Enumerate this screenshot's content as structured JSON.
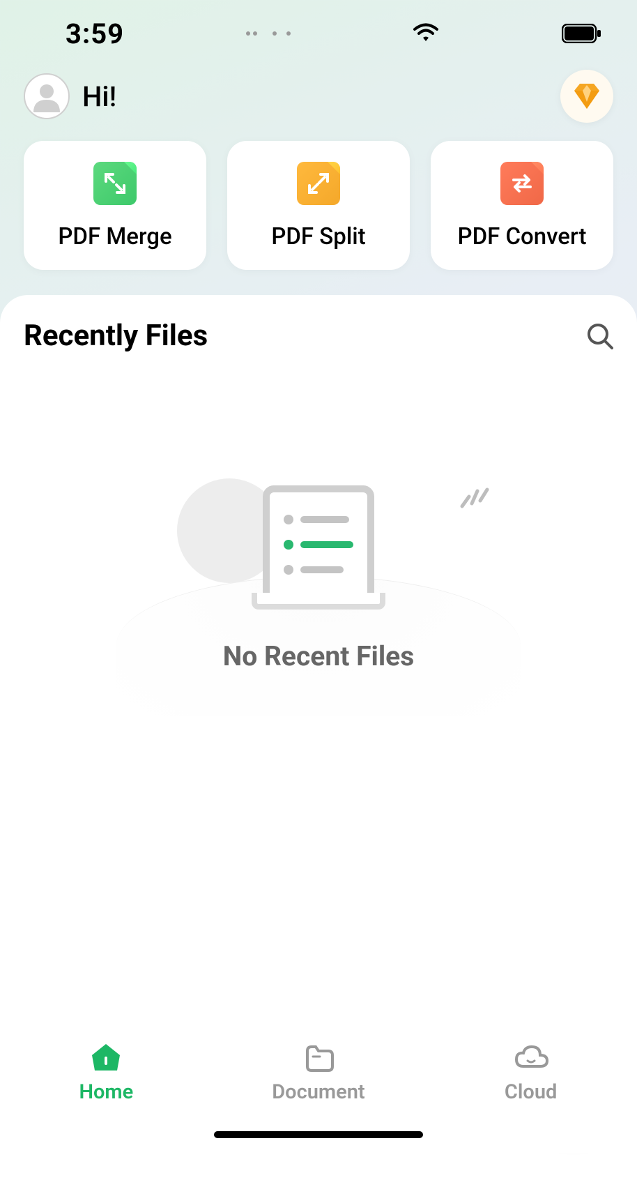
{
  "status_bar": {
    "time": "3:59"
  },
  "header": {
    "greeting": "Hi!"
  },
  "tools": [
    {
      "label": "PDF Merge",
      "icon": "merge-icon",
      "color": "green"
    },
    {
      "label": "PDF Split",
      "icon": "split-icon",
      "color": "orange"
    },
    {
      "label": "PDF Convert",
      "icon": "convert-icon",
      "color": "red"
    }
  ],
  "recent": {
    "title": "Recently Files",
    "empty_text": "No Recent Files"
  },
  "nav": {
    "items": [
      {
        "label": "Home",
        "icon": "home-icon",
        "active": true
      },
      {
        "label": "Document",
        "icon": "document-icon",
        "active": false
      },
      {
        "label": "Cloud",
        "icon": "cloud-icon",
        "active": false
      }
    ]
  }
}
